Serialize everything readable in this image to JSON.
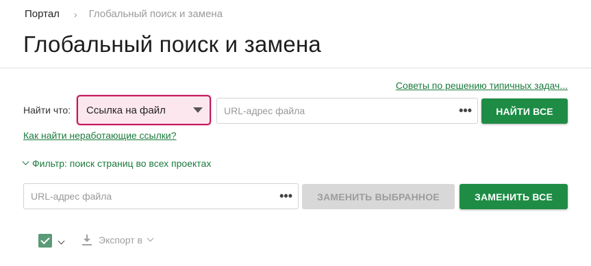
{
  "breadcrumb": {
    "root": "Портал",
    "separator": "›",
    "current": "Глобальный поиск и замена"
  },
  "page_title": "Глобальный поиск и замена",
  "tips_link": "Советы по решению типичных задач...",
  "find": {
    "label": "Найти что:",
    "type_selected": "Ссылка на файл",
    "input_placeholder": "URL-адрес файла",
    "more_icon": "ellipsis-icon",
    "find_all_label": "НАЙТИ ВСЕ"
  },
  "broken_links_link": "Как найти неработающие ссылки?",
  "filter_label": "Фильтр: поиск страниц во всех проектах",
  "replace": {
    "input_placeholder": "URL-адрес файла",
    "replace_selected_label": "ЗАМЕНИТЬ ВЫБРАННОЕ",
    "replace_all_label": "ЗАМЕНИТЬ ВСЕ"
  },
  "toolbar": {
    "export_label": "Экспорт в"
  },
  "colors": {
    "accent_green": "#1e8c45",
    "link_green": "#1a7a3c",
    "select_border": "#c2185b",
    "select_bg": "#fde7ee"
  }
}
